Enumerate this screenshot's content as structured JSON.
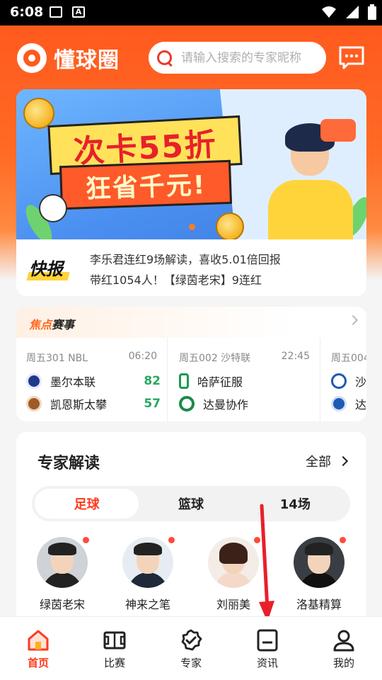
{
  "status_bar": {
    "time": "6:08"
  },
  "header": {
    "app_name": "懂球圈",
    "search_placeholder": "请输入搜索的专家昵称",
    "accent_color": "#ff5a1e"
  },
  "banner": {
    "line1": "次卡55折",
    "line2": "狂省千元!"
  },
  "news": {
    "label": "快报",
    "lines": [
      "李乐君连红9场解读，喜收5.01倍回报",
      "带红1054人！【绿茵老宋】9连红"
    ]
  },
  "focus": {
    "title_highlight": "焦点",
    "title_rest": "赛事",
    "matches": [
      {
        "meta": "周五301 NBL",
        "time": "06:20",
        "home": "墨尔本联",
        "away": "凯恩斯太攀",
        "home_score": "82",
        "away_score": "57"
      },
      {
        "meta": "周五002 沙特联",
        "time": "22:45",
        "home": "哈萨征服",
        "away": "达曼协作",
        "home_score": "",
        "away_score": ""
      },
      {
        "meta": "周五004",
        "time": "",
        "home": "沙",
        "away": "达",
        "home_score": "",
        "away_score": ""
      }
    ],
    "score_color": "#27a85f"
  },
  "experts": {
    "title": "专家解读",
    "all_label": "全部",
    "tabs": [
      "足球",
      "篮球",
      "14场"
    ],
    "active_tab": "足球",
    "list": [
      {
        "name": "绿茵老宋"
      },
      {
        "name": "神来之笔"
      },
      {
        "name": "刘丽美"
      },
      {
        "name": "洛基精算"
      }
    ]
  },
  "bottom_nav": {
    "items": [
      {
        "label": "首页",
        "icon": "home-icon",
        "active": true
      },
      {
        "label": "比赛",
        "icon": "pitch-icon",
        "active": false
      },
      {
        "label": "专家",
        "icon": "badge-check-icon",
        "active": false
      },
      {
        "label": "资讯",
        "icon": "news-icon",
        "active": false
      },
      {
        "label": "我的",
        "icon": "user-icon",
        "active": false
      }
    ]
  }
}
